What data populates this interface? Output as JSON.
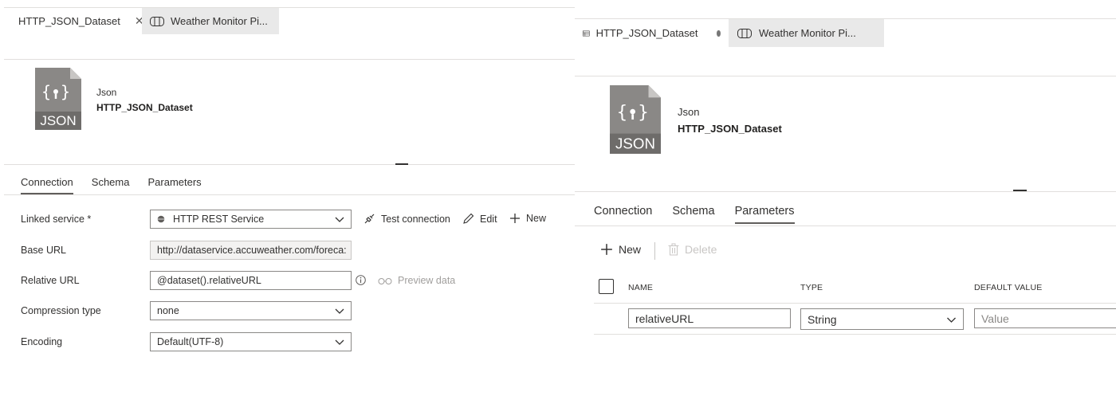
{
  "left": {
    "tabs": [
      {
        "label": "HTTP_JSON_Dataset",
        "close": "✕"
      },
      {
        "label": "Weather Monitor Pi..."
      }
    ],
    "dataset": {
      "type": "Json",
      "name": "HTTP_JSON_Dataset",
      "icon_label": "JSON"
    },
    "subtabs": [
      "Connection",
      "Schema",
      "Parameters"
    ],
    "active_subtab": "Connection",
    "form": {
      "linked_service_label": "Linked service *",
      "linked_service_value": "HTTP REST Service",
      "test_connection": "Test connection",
      "edit": "Edit",
      "new": "New",
      "base_url_label": "Base URL",
      "base_url_value": "http://dataservice.accuweather.com/foreca:",
      "relative_url_label": "Relative URL",
      "relative_url_value": "@dataset().relativeURL",
      "preview_data": "Preview data",
      "compression_label": "Compression type",
      "compression_value": "none",
      "encoding_label": "Encoding",
      "encoding_value": "Default(UTF-8)"
    }
  },
  "right": {
    "tabs": [
      {
        "label": "HTTP_JSON_Dataset"
      },
      {
        "label": "Weather Monitor Pi..."
      }
    ],
    "dataset": {
      "type": "Json",
      "name": "HTTP_JSON_Dataset",
      "icon_label": "JSON"
    },
    "subtabs": [
      "Connection",
      "Schema",
      "Parameters"
    ],
    "active_subtab": "Parameters",
    "toolbar": {
      "new": "New",
      "delete": "Delete"
    },
    "grid": {
      "columns": [
        "NAME",
        "TYPE",
        "DEFAULT VALUE"
      ],
      "rows": [
        {
          "name": "relativeURL",
          "type": "String",
          "default_placeholder": "Value"
        }
      ]
    }
  },
  "colors": {
    "accent_underline": "#605e5c",
    "icon_gray": "#8a8886",
    "disabled": "#a19f9d"
  }
}
